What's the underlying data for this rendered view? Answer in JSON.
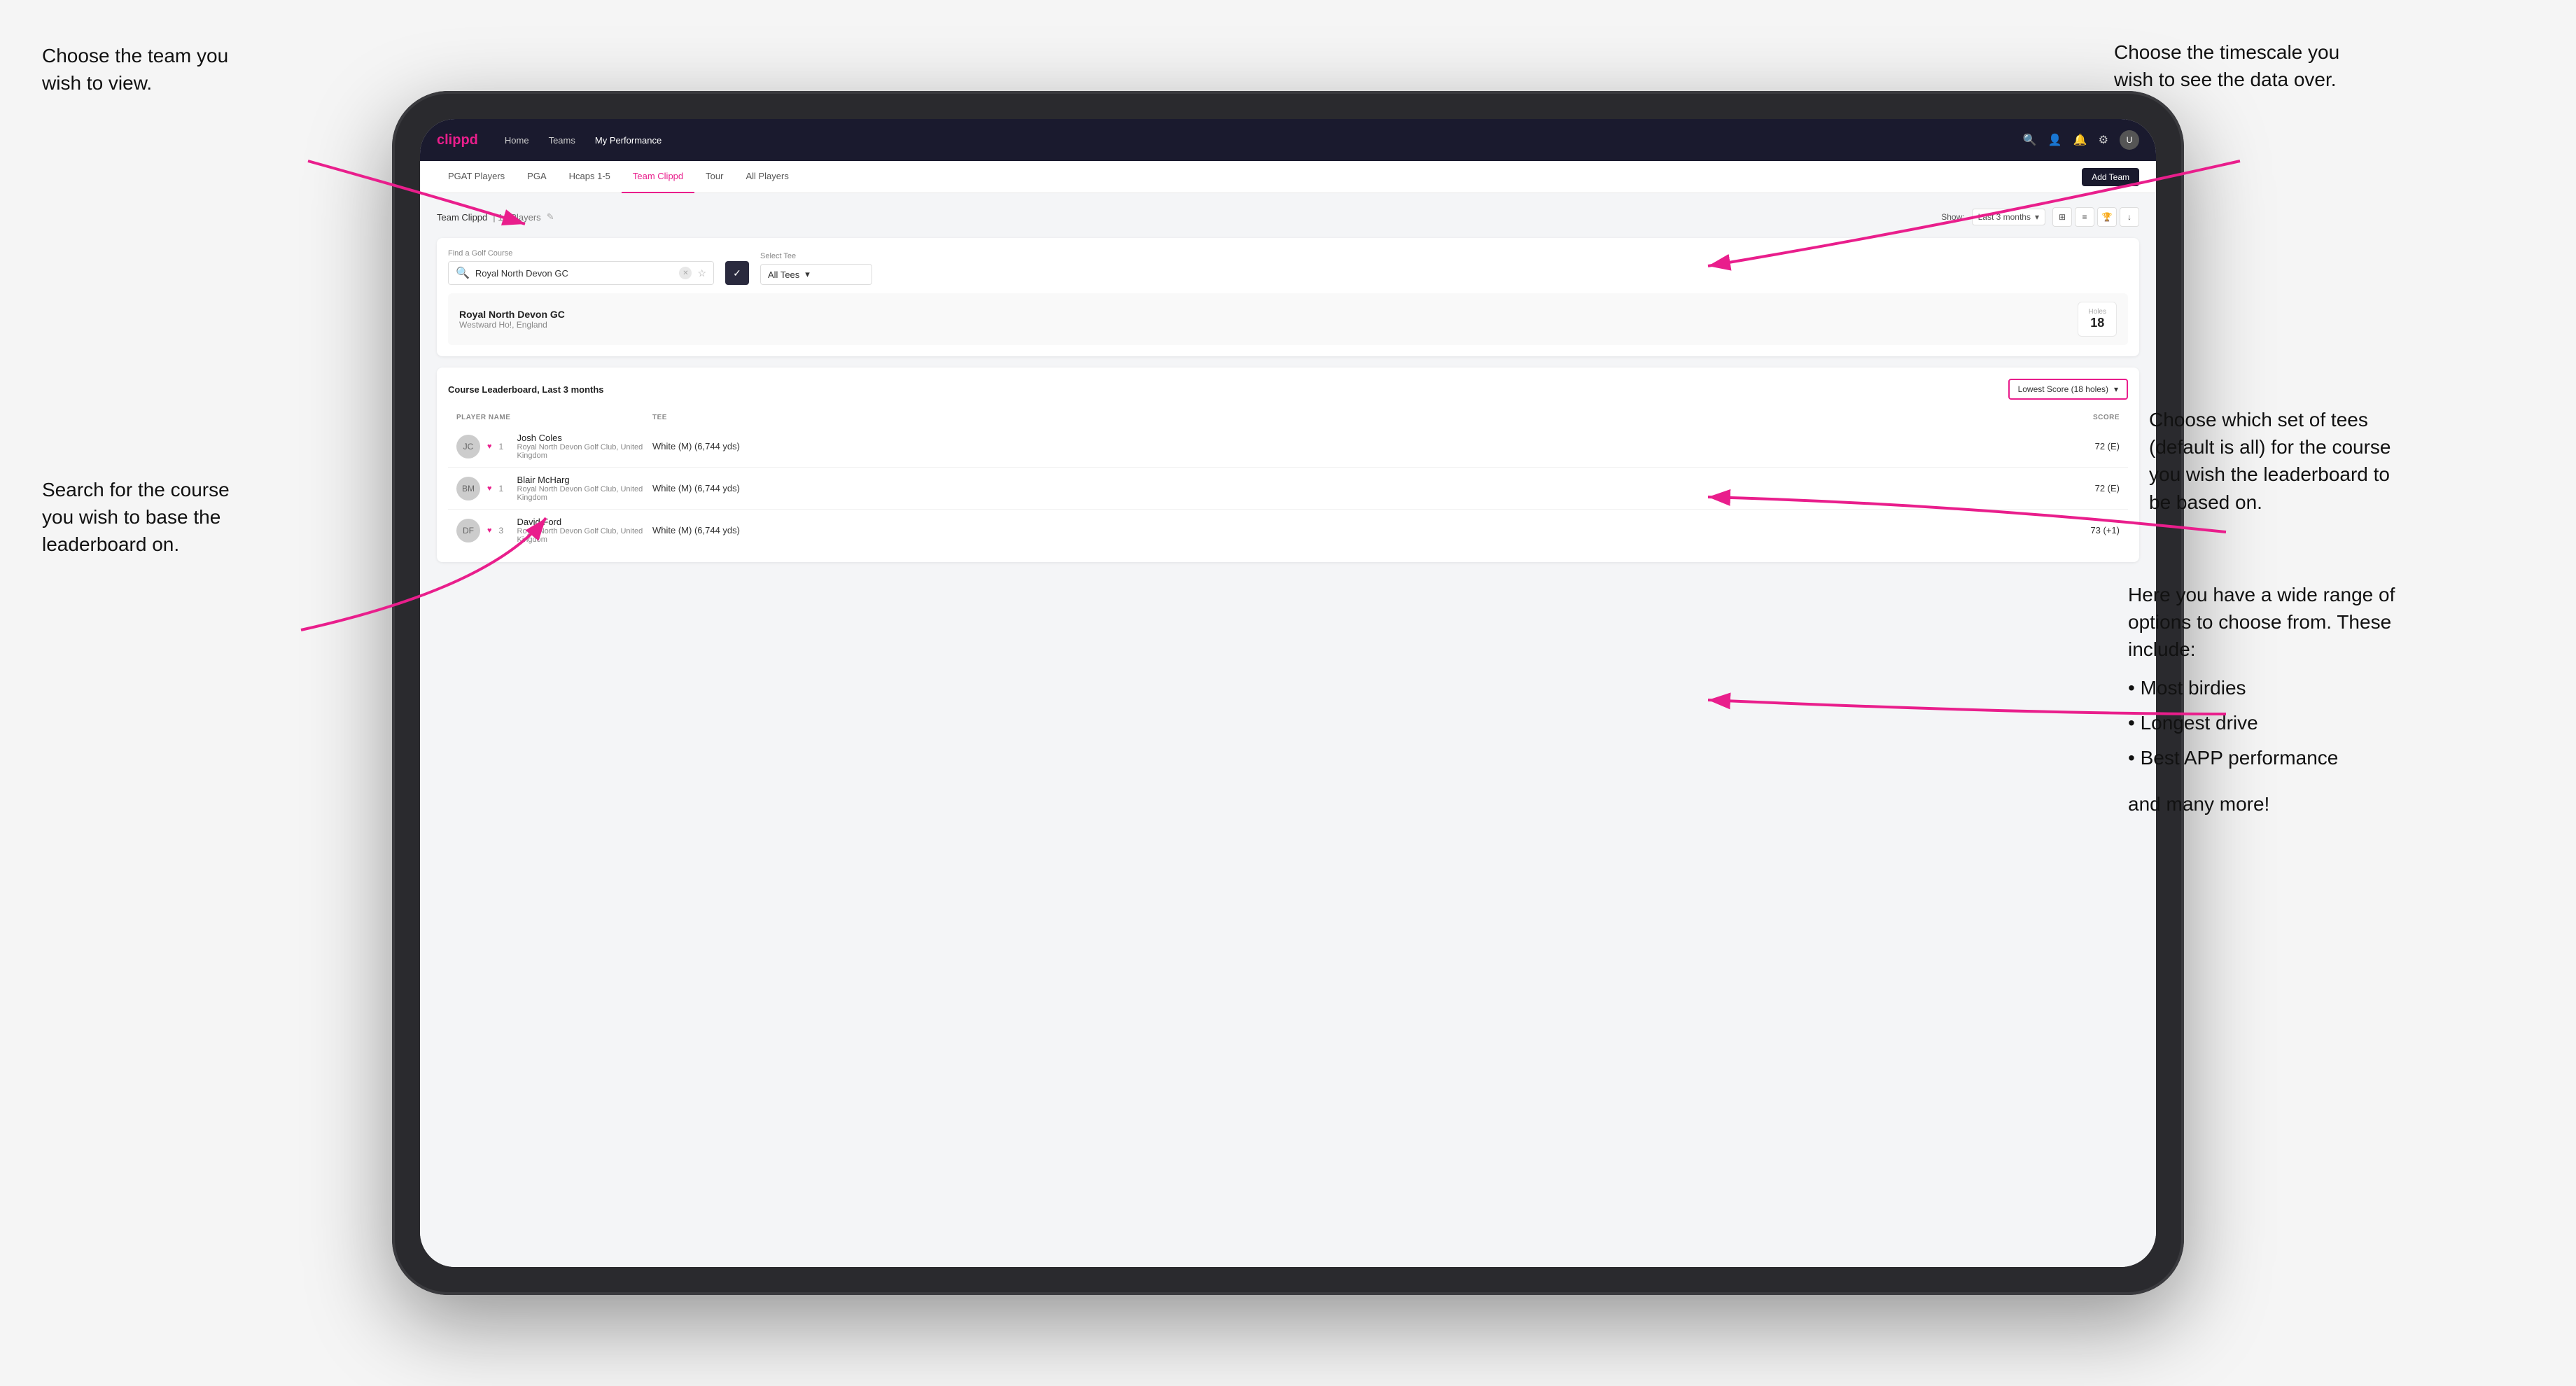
{
  "annotations": {
    "top_left": {
      "line1": "Choose the team you",
      "line2": "wish to view."
    },
    "top_right": {
      "line1": "Choose the timescale you",
      "line2": "wish to see the data over."
    },
    "mid_left": {
      "line1": "Search for the course",
      "line2": "you wish to base the",
      "line3": "leaderboard on."
    },
    "mid_right": {
      "line1": "Choose which set of tees",
      "line2": "(default is all) for the course",
      "line3": "you wish the leaderboard to",
      "line4": "be based on."
    },
    "bottom_right": {
      "intro": "Here you have a wide range of options to choose from. These include:",
      "bullets": [
        "Most birdies",
        "Longest drive",
        "Best APP performance"
      ],
      "outro": "and many more!"
    }
  },
  "navbar": {
    "logo": "clippd",
    "links": [
      "Home",
      "Teams",
      "My Performance"
    ],
    "active_link": "My Performance"
  },
  "sub_nav": {
    "tabs": [
      "PGAT Players",
      "PGA",
      "Hcaps 1-5",
      "Team Clippd",
      "Tour",
      "All Players"
    ],
    "active_tab": "Team Clippd",
    "add_team_label": "Add Team"
  },
  "team_section": {
    "title": "Team Clippd",
    "count": "14 Players",
    "show_label": "Show:",
    "show_value": "Last 3 months"
  },
  "course_search": {
    "label": "Find a Golf Course",
    "placeholder": "Royal North Devon GC",
    "value": "Royal North Devon GC",
    "tee_label": "Select Tee",
    "tee_value": "All Tees"
  },
  "course_result": {
    "name": "Royal North Devon GC",
    "location": "Westward Ho!, England",
    "holes_label": "Holes",
    "holes_value": "18"
  },
  "leaderboard": {
    "title": "Course Leaderboard,",
    "subtitle": "Last 3 months",
    "score_type": "Lowest Score (18 holes)",
    "columns": [
      "PLAYER NAME",
      "TEE",
      "SCORE"
    ],
    "players": [
      {
        "rank": "1",
        "name": "Josh Coles",
        "club": "Royal North Devon Golf Club, United Kingdom",
        "tee": "White (M) (6,744 yds)",
        "score": "72 (E)"
      },
      {
        "rank": "1",
        "name": "Blair McHarg",
        "club": "Royal North Devon Golf Club, United Kingdom",
        "tee": "White (M) (6,744 yds)",
        "score": "72 (E)"
      },
      {
        "rank": "3",
        "name": "David Ford",
        "club": "Royal North Devon Golf Club, United Kingdom",
        "tee": "White (M) (6,744 yds)",
        "score": "73 (+1)"
      }
    ]
  },
  "icons": {
    "search": "🔍",
    "star": "☆",
    "clear": "✕",
    "chevron_down": "▾",
    "grid": "⊞",
    "list": "≡",
    "trophy": "🏆",
    "download": "↓",
    "bell": "🔔",
    "settings": "⚙",
    "edit": "✎",
    "heart": "♥"
  }
}
